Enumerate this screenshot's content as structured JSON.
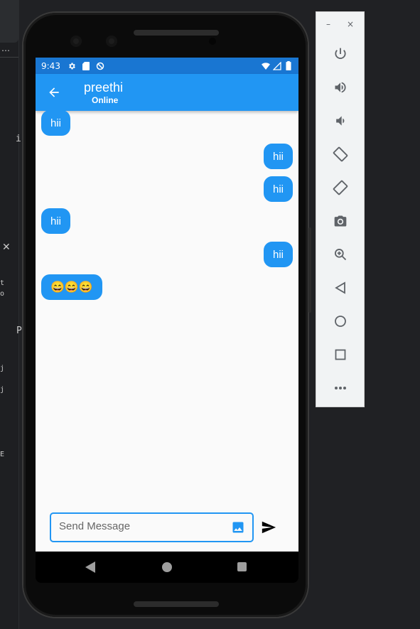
{
  "ide": {
    "text_items": [
      "t",
      "o",
      "ic",
      "P",
      "j",
      "j",
      "E"
    ]
  },
  "phone": {
    "status_time": "9:43",
    "app_title": "preethi",
    "app_subtitle": "Online",
    "messages": [
      {
        "text": "hii",
        "side": "left"
      },
      {
        "text": "hii",
        "side": "right"
      },
      {
        "text": "hii",
        "side": "right"
      },
      {
        "text": "hii",
        "side": "left"
      },
      {
        "text": "hii",
        "side": "right"
      },
      {
        "text": "😄😄😄",
        "side": "left"
      }
    ],
    "input_placeholder": "Send Message",
    "accent_color": "#2196f3",
    "statusbar_color": "#1976d2"
  },
  "emulator_toolbar": {
    "minimize": "–",
    "close": "×",
    "buttons": [
      "power-icon",
      "volume-up-icon",
      "volume-down-icon",
      "rotate-left-icon",
      "rotate-right-icon",
      "camera-icon",
      "zoom-icon",
      "back-icon",
      "home-icon",
      "overview-icon",
      "more-icon"
    ]
  }
}
